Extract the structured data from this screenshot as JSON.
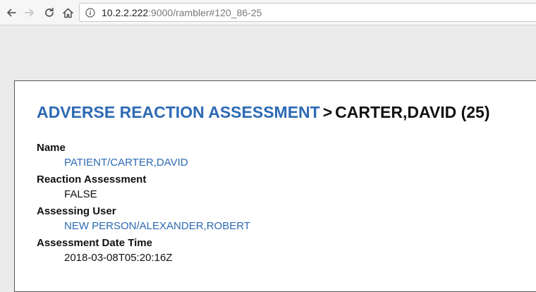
{
  "browser": {
    "url_host": "10.2.2.222",
    "url_rest": ":9000/rambler#120_86-25"
  },
  "page": {
    "title_link": "ADVERSE REACTION ASSESSMENT",
    "title_separator": ">",
    "title_rest": "CARTER,DAVID (25)",
    "link_color": "#2d6ab3",
    "fields": [
      {
        "label": "Name",
        "value": "PATIENT/CARTER,DAVID",
        "is_link": true
      },
      {
        "label": "Reaction Assessment",
        "value": "FALSE",
        "is_link": false
      },
      {
        "label": "Assessing User",
        "value": "NEW PERSON/ALEXANDER,ROBERT",
        "is_link": true
      },
      {
        "label": "Assessment Date Time",
        "value": "2018-03-08T05:20:16Z",
        "is_link": false
      }
    ]
  },
  "icons": {
    "back": "arrow-left-icon",
    "forward": "arrow-right-icon",
    "reload": "reload-icon",
    "home": "home-icon",
    "info": "info-icon"
  }
}
